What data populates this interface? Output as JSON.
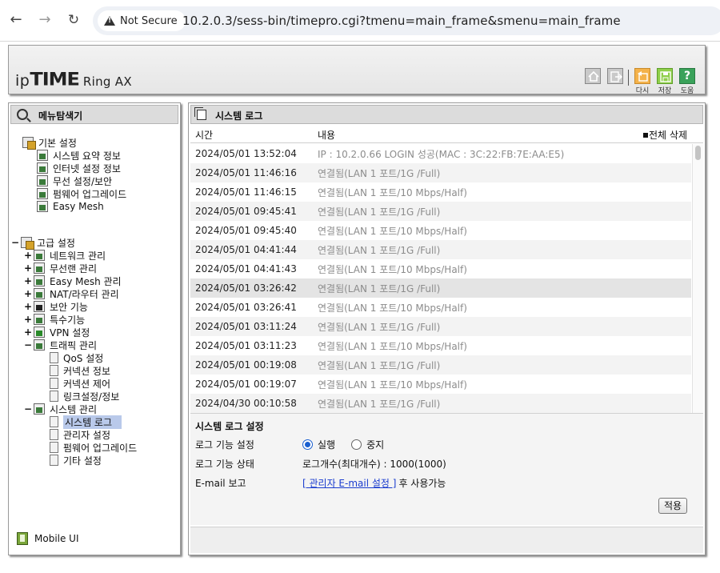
{
  "browser": {
    "security_label": "Not Secure",
    "url": "10.2.0.3/sess-bin/timepro.cgi?tmenu=main_frame&smenu=main_frame"
  },
  "header": {
    "logo_ip": "ip",
    "logo_time": "TIME",
    "model": "Ring AX",
    "toolbar": {
      "reset_label": "다시",
      "save_label": "저장",
      "help_label": "도움"
    }
  },
  "menu": {
    "title": "메뉴탐색기",
    "basic": {
      "label": "기본 설정",
      "items": [
        "시스템 요약 정보",
        "인터넷 설정 정보",
        "무선 설정/보안",
        "펌웨어 업그레이드",
        "Easy Mesh"
      ]
    },
    "advanced": {
      "toggle": "−",
      "label": "고급 설정",
      "groups": [
        {
          "toggle": "+",
          "label": "네트워크 관리"
        },
        {
          "toggle": "+",
          "label": "무선랜 관리"
        },
        {
          "toggle": "+",
          "label": "Easy Mesh 관리"
        },
        {
          "toggle": "+",
          "label": "NAT/라우터 관리"
        },
        {
          "toggle": "+",
          "label": "보안 기능"
        },
        {
          "toggle": "+",
          "label": "특수기능"
        },
        {
          "toggle": "+",
          "label": "VPN 설정"
        },
        {
          "toggle": "−",
          "label": "트래픽 관리"
        },
        {
          "toggle": "−",
          "label": "시스템 관리"
        }
      ],
      "traffic_items": [
        "QoS 설정",
        "커넥션 정보",
        "커넥션 제어",
        "링크설정/정보"
      ],
      "system_items": [
        "시스템 로그",
        "관리자 설정",
        "펌웨어 업그레이드",
        "기타 설정"
      ]
    },
    "mobile": "Mobile UI"
  },
  "content": {
    "title": "시스템 로그",
    "col_time": "시간",
    "col_msg": "내용",
    "delete_all": "전체 삭제",
    "logs": [
      {
        "time": "2024/05/01 13:52:04",
        "msg": "IP : 10.2.0.66 LOGIN 성공(MAC : 3C:22:FB:7E:AA:E5)"
      },
      {
        "time": "2024/05/01 11:46:16",
        "msg": "연결됨(LAN 1 포트/1G /Full)"
      },
      {
        "time": "2024/05/01 11:46:15",
        "msg": "연결됨(LAN 1 포트/10 Mbps/Half)"
      },
      {
        "time": "2024/05/01 09:45:41",
        "msg": "연결됨(LAN 1 포트/1G /Full)"
      },
      {
        "time": "2024/05/01 09:45:40",
        "msg": "연결됨(LAN 1 포트/10 Mbps/Half)"
      },
      {
        "time": "2024/05/01 04:41:44",
        "msg": "연결됨(LAN 1 포트/1G /Full)"
      },
      {
        "time": "2024/05/01 04:41:43",
        "msg": "연결됨(LAN 1 포트/10 Mbps/Half)"
      },
      {
        "time": "2024/05/01 03:26:42",
        "msg": "연결됨(LAN 1 포트/1G /Full)"
      },
      {
        "time": "2024/05/01 03:26:41",
        "msg": "연결됨(LAN 1 포트/10 Mbps/Half)"
      },
      {
        "time": "2024/05/01 03:11:24",
        "msg": "연결됨(LAN 1 포트/1G /Full)"
      },
      {
        "time": "2024/05/01 03:11:23",
        "msg": "연결됨(LAN 1 포트/10 Mbps/Half)"
      },
      {
        "time": "2024/05/01 00:19:08",
        "msg": "연결됨(LAN 1 포트/1G /Full)"
      },
      {
        "time": "2024/05/01 00:19:07",
        "msg": "연결됨(LAN 1 포트/10 Mbps/Half)"
      },
      {
        "time": "2024/04/30 00:10:58",
        "msg": "연결됨(LAN 1 포트/1G /Full)"
      }
    ],
    "settings": {
      "title": "시스템 로그 설정",
      "log_function_label": "로그 기능 설정",
      "radio_run": "실행",
      "radio_stop": "중지",
      "log_status_label": "로그 기능 상태",
      "log_status_value": "로그개수(최대개수) : 1000(1000)",
      "email_label": "E-mail 보고",
      "email_link": "[ 관리자 E-mail 설정 ]",
      "email_suffix": "후 사용가능",
      "apply": "적용"
    }
  }
}
